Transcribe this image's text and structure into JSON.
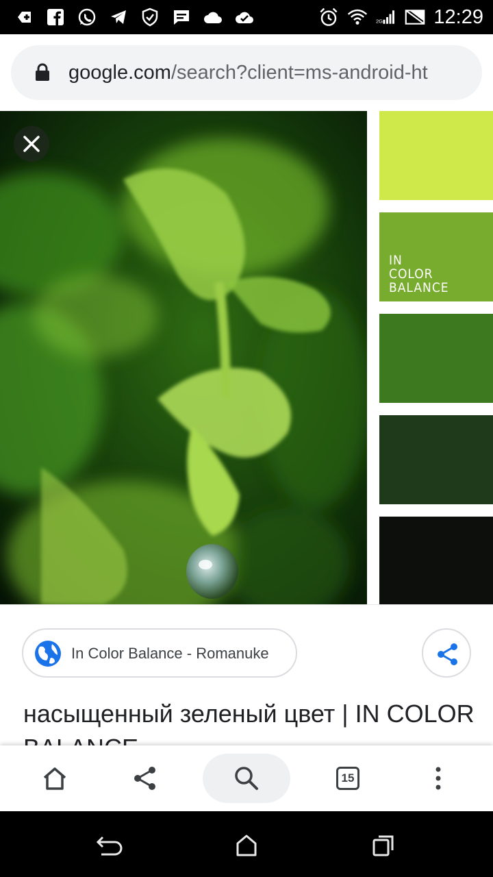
{
  "status_bar": {
    "time": "12:29",
    "icons": [
      "add-box-icon",
      "facebook-icon",
      "whatsapp-icon",
      "telegram-icon",
      "shield-icon",
      "chat-icon",
      "cloud-icon",
      "cloud-check-icon"
    ],
    "right_icons": [
      "alarm-icon",
      "wifi-icon",
      "signal-icon",
      "no-sim-icon"
    ]
  },
  "address_bar": {
    "host": "google.com",
    "path": "/search?client=ms-android-ht"
  },
  "image_viewer": {
    "brand_lines": [
      "IN",
      "COLOR",
      "BALANCE"
    ],
    "swatch_colors": [
      "#cfe84a",
      "#78ac2e",
      "#3d7a1f",
      "#1e3a1a",
      "#0c0f0c"
    ]
  },
  "result": {
    "source": "In Color Balance - Romanuke",
    "title": "насыщенный зеленый цвет | IN COLOR BALANCE"
  },
  "bottom_nav": {
    "tab_count": "15",
    "items": [
      "home-icon",
      "share-icon",
      "search-icon",
      "tabs-icon",
      "more-icon"
    ]
  },
  "system_nav": [
    "back-icon",
    "home-icon",
    "recents-icon"
  ]
}
